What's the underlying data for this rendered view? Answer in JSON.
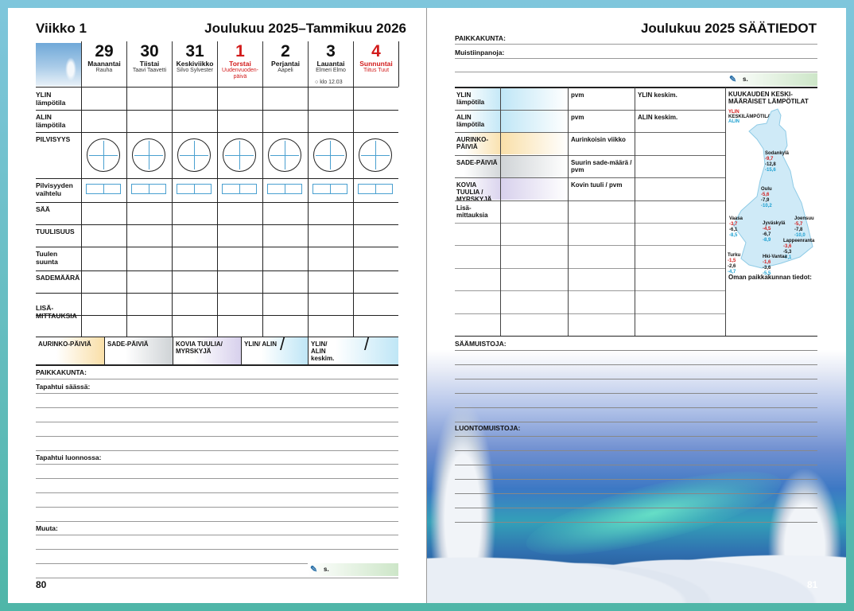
{
  "left": {
    "week": "Viikko 1",
    "range": "Joulukuu 2025–Tammikuu 2026",
    "days": [
      {
        "num": "29",
        "name": "Maanantai",
        "names": "Rauha",
        "red": false
      },
      {
        "num": "30",
        "name": "Tiistai",
        "names": "Taavi Taavetti",
        "red": false
      },
      {
        "num": "31",
        "name": "Keskiviikko",
        "names": "Silvo Sylvester",
        "red": false
      },
      {
        "num": "1",
        "name": "Torstai",
        "names": "Uudenvuoden-päivä",
        "red": true
      },
      {
        "num": "2",
        "name": "Perjantai",
        "names": "Aapeli",
        "red": false
      },
      {
        "num": "3",
        "name": "Lauantai",
        "names": "Elmeri Elmo",
        "red": false,
        "moon": "klo 12.03"
      },
      {
        "num": "4",
        "name": "Sunnuntai",
        "names": "Tiitus Tuut",
        "red": true
      }
    ],
    "rows": [
      "YLIN lämpötila",
      "ALIN lämpötila",
      "PILVISYYS",
      "Pilvisyyden vaihtelu",
      "SÄÄ",
      "TUULISUUS",
      "Tuulen suunta",
      "SADEMÄÄRÄ",
      "LISÄ-MITTAUKSIA"
    ],
    "summary": [
      "AURINKO-PÄIVIÄ",
      "SADE-PÄIVIÄ",
      "KOVIA TUULIA/ MYRSKYJÄ",
      "YLIN/ ALIN",
      "YLIN/ ALIN keskim."
    ],
    "place": "PAIKKAKUNTA:",
    "weather_note": "Tapahtui säässä:",
    "nature_note": "Tapahtui luonnossa:",
    "other_note": "Muuta:",
    "pencil": "s.",
    "page_number": "80"
  },
  "right": {
    "title": "Joulukuu 2025 SÄÄTIEDOT",
    "place": "PAIKKAKUNTA:",
    "memo": "Muistiinpanoja:",
    "pencil": "s.",
    "table": [
      {
        "label": "YLIN lämpötila",
        "mid": "pvm",
        "right": "YLIN keskim."
      },
      {
        "label": "ALIN lämpötila",
        "mid": "pvm",
        "right": "ALIN keskim."
      },
      {
        "label": "AURINKO-PÄIVIÄ",
        "mid": "Aurinkoisin viikko",
        "right": ""
      },
      {
        "label": "SADE-PÄIVIÄ",
        "mid": "Suurin sade-määrä / pvm",
        "right": ""
      },
      {
        "label": "KOVIA TUULIA / MYRSKYJÄ",
        "mid": "Kovin tuuli / pvm",
        "right": ""
      },
      {
        "label": "Lisä-mittauksia",
        "mid": "",
        "right": ""
      }
    ],
    "map_title": "KUUKAUDEN KESKI-MÄÄRÄISET LÄMPÖTILAT",
    "legend": {
      "ylin": "YLIN",
      "keski": "KESKILÄMPÖTILA",
      "alin": "ALIN"
    },
    "cities": [
      {
        "name": "Sodankylä",
        "vals": [
          "-9,7",
          "-12,8",
          "-15,6"
        ]
      },
      {
        "name": "Oulu",
        "vals": [
          "-5,6",
          "-7,9",
          "-10,2"
        ]
      },
      {
        "name": "Vaasa",
        "vals": [
          "-3,7",
          "-6,1",
          "-8,5"
        ]
      },
      {
        "name": "Joensuu",
        "vals": [
          "-5,7",
          "-7,8",
          "-10,0"
        ]
      },
      {
        "name": "Jyväskylä",
        "vals": [
          "-4,5",
          "-6,7",
          "-8,9"
        ]
      },
      {
        "name": "Lappeenranta",
        "vals": [
          "-3,6",
          "-5,3",
          "-7,1"
        ]
      },
      {
        "name": "Turku",
        "vals": [
          "-1,5",
          "-2,6",
          "-4,7"
        ]
      },
      {
        "name": "Hki-Vantaa",
        "vals": [
          "-1,6",
          "-3,6",
          "-5,5"
        ]
      }
    ],
    "own": "Oman paikkakunnan tiedot:",
    "weather_memo": "SÄÄMUISTOJA:",
    "nature_memo": "LUONTOMUISTOJA:",
    "page_number": "81",
    "colors": {
      "sun": "#f9dfa8",
      "rain": "#cfd3d6",
      "wind": "#d7d0ec",
      "temp": "#bfe6f6"
    }
  }
}
